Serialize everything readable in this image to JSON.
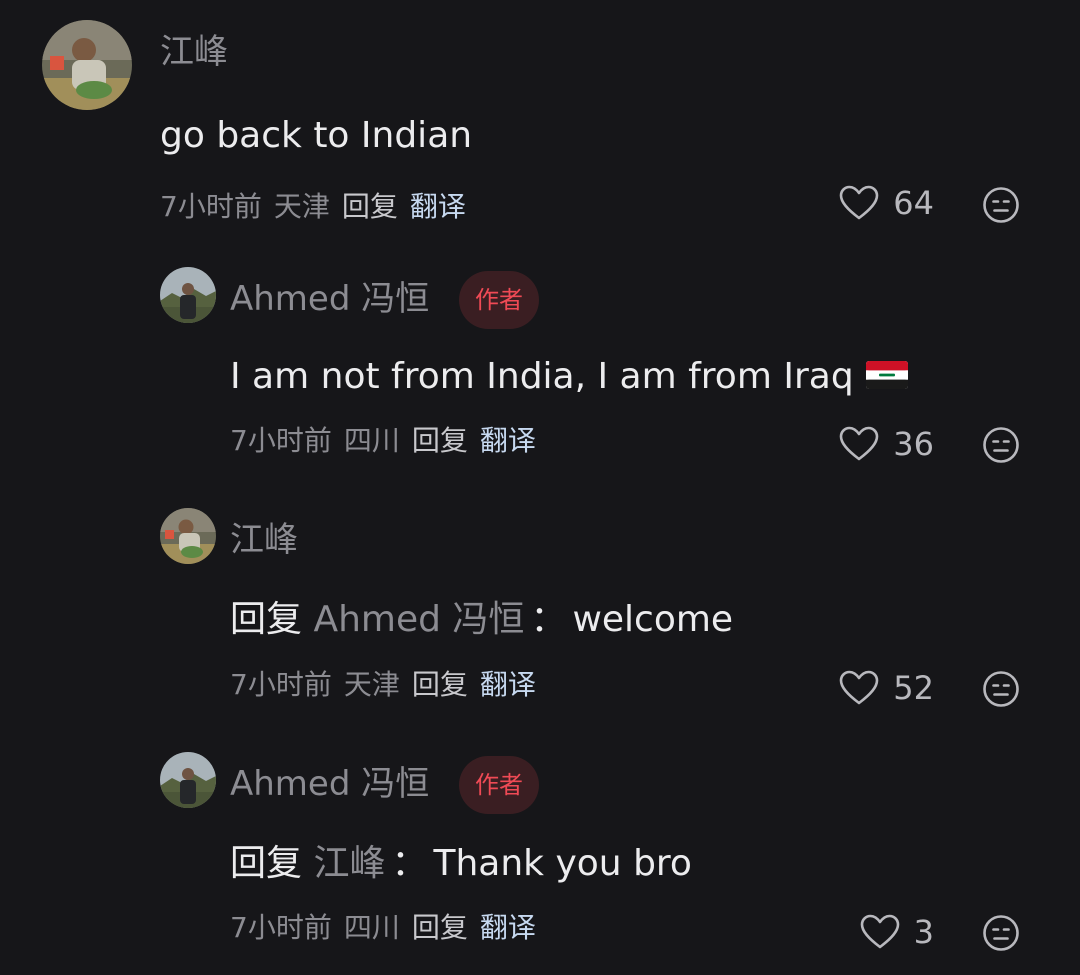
{
  "comments": [
    {
      "username": "江峰",
      "text": "go back to Indian",
      "meta": {
        "time": "7小时前",
        "location": "天津",
        "reply": "回复",
        "translate": "翻译"
      },
      "likes": "64"
    },
    {
      "username": "Ahmed 冯恒",
      "badge": "作者",
      "text": "I am not from India, I am from Iraq",
      "flag": "iraq-flag",
      "meta": {
        "time": "7小时前",
        "location": "四川",
        "reply": "回复",
        "translate": "翻译"
      },
      "likes": "36"
    },
    {
      "username": "江峰",
      "reply_word": "回复",
      "reply_target": "Ahmed 冯恒",
      "colon": "：",
      "text": "welcome",
      "meta": {
        "time": "7小时前",
        "location": "天津",
        "reply": "回复",
        "translate": "翻译"
      },
      "likes": "52"
    },
    {
      "username": "Ahmed 冯恒",
      "badge": "作者",
      "reply_word": "回复",
      "reply_target": "江峰",
      "colon": "：",
      "text": "Thank you bro",
      "meta": {
        "time": "7小时前",
        "location": "四川",
        "reply": "回复",
        "translate": "翻译"
      },
      "likes": "3"
    }
  ],
  "colors": {
    "background": "#161619",
    "badge_bg": "#3a1e22",
    "badge_text": "#ef4a55",
    "translate_link": "#c7d9f0",
    "muted": "#8c8c92"
  },
  "icons": [
    "heart-icon",
    "dislike-face-icon"
  ]
}
